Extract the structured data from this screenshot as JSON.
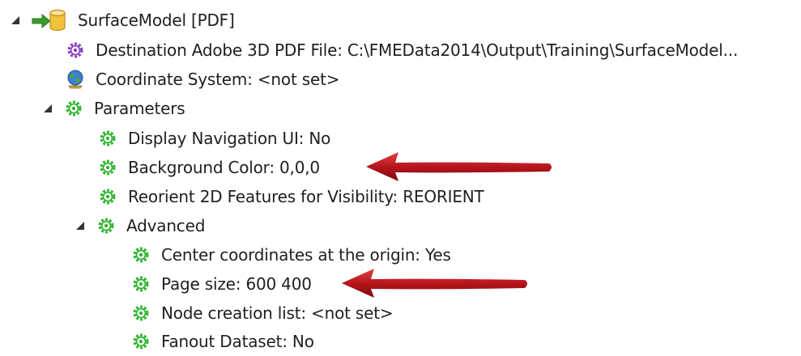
{
  "tree": {
    "root": {
      "label": "SurfaceModel [PDF]",
      "icon": "feature-type-database-icon"
    },
    "destination": {
      "label": "Destination Adobe 3D PDF File: C:\\FMEData2014\\Output\\Training\\SurfaceModel...",
      "icon": "purple-gear-icon"
    },
    "coordinate_system": {
      "label": "Coordinate System: <not set>",
      "icon": "globe-icon"
    },
    "parameters": {
      "label": "Parameters",
      "icon": "green-gear-icon",
      "items": [
        {
          "label": "Display Navigation UI: No",
          "icon": "green-gear-icon"
        },
        {
          "label": "Background Color: 0,0,0",
          "icon": "green-gear-icon"
        },
        {
          "label": "Reorient 2D Features for Visibility: REORIENT",
          "icon": "green-gear-icon"
        }
      ]
    },
    "advanced": {
      "label": "Advanced",
      "icon": "green-gear-icon",
      "items": [
        {
          "label": "Center coordinates at the origin: Yes",
          "icon": "green-gear-icon"
        },
        {
          "label": "Page size: 600 400",
          "icon": "green-gear-icon"
        },
        {
          "label": "Node creation list: <not set>",
          "icon": "green-gear-icon"
        },
        {
          "label": "Fanout Dataset: No",
          "icon": "green-gear-icon"
        }
      ]
    }
  },
  "colors": {
    "text": "#1f1f1f",
    "arrow": "#b8141c",
    "gear_green": "#2db52d",
    "gear_purple": "#8a3fbf",
    "toggle": "#333333"
  }
}
